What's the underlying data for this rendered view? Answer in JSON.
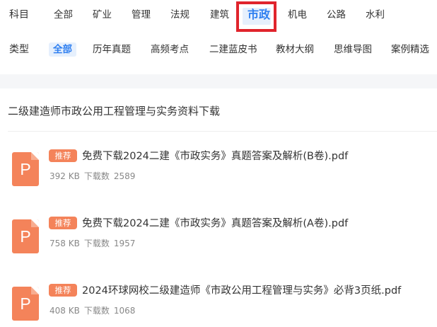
{
  "filters": {
    "subject": {
      "label": "科目",
      "options": [
        "全部",
        "矿业",
        "管理",
        "法规",
        "建筑",
        "市政",
        "机电",
        "公路",
        "水利"
      ],
      "selected": "市政"
    },
    "type": {
      "label": "类型",
      "options": [
        "全部",
        "历年真题",
        "高频考点",
        "二建蓝皮书",
        "教材大纲",
        "思维导图",
        "案例精选"
      ],
      "selected": "全部"
    }
  },
  "section": {
    "title": "二级建造师市政公用工程管理与实务资料下载"
  },
  "files": [
    {
      "icon": "P",
      "badge": "推荐",
      "name": "免费下载2024二建《市政实务》真题答案及解析(B卷).pdf",
      "size": "392 KB",
      "downloads_label": "下载数",
      "downloads": "2589"
    },
    {
      "icon": "P",
      "badge": "推荐",
      "name": "免费下载2024二建《市政实务》真题答案及解析(A卷).pdf",
      "size": "758 KB",
      "downloads_label": "下载数",
      "downloads": "1957"
    },
    {
      "icon": "P",
      "badge": "推荐",
      "name": "2024环球网校二级建造师《市政公用工程管理与实务》必背3页纸.pdf",
      "size": "408 KB",
      "downloads_label": "下载数",
      "downloads": "1068"
    }
  ],
  "colors": {
    "accent": "#2f7ff0",
    "highlight": "#e0242c",
    "file_icon": "#f4835a"
  }
}
